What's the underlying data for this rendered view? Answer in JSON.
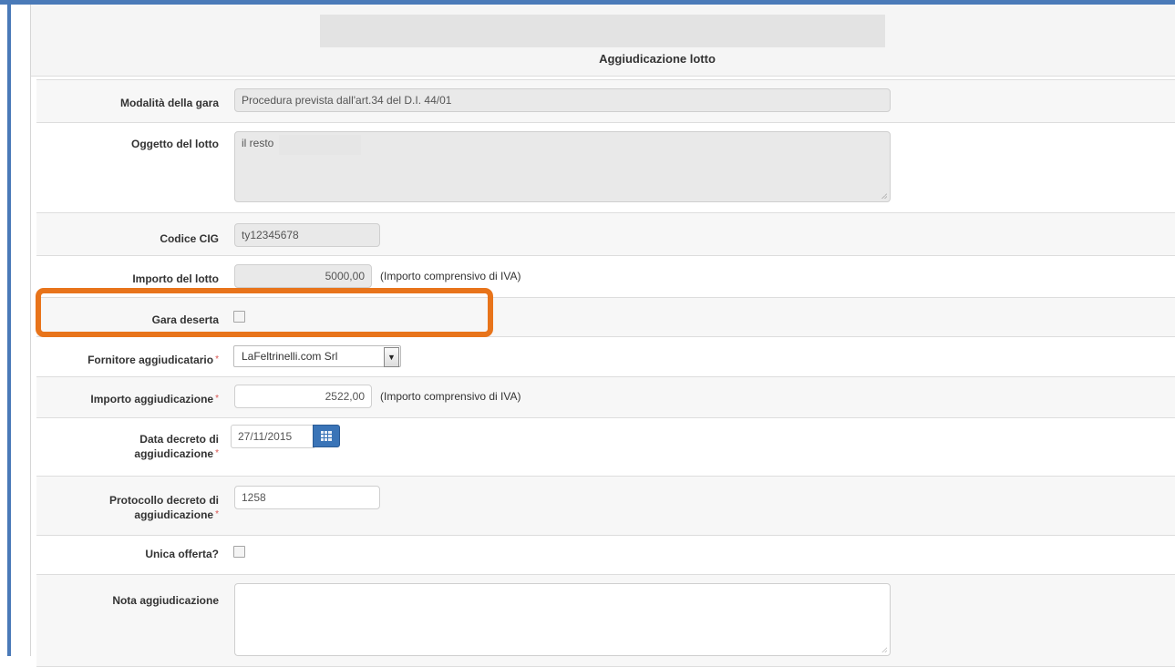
{
  "section": {
    "title": "Aggiudicazione lotto"
  },
  "fields": {
    "modalita": {
      "label": "Modalità  della gara",
      "value": "Procedura prevista dall'art.34 del D.I. 44/01"
    },
    "oggetto": {
      "label": "Oggetto del lotto",
      "value": "il resto"
    },
    "cig": {
      "label": "Codice CIG",
      "value": "ty12345678"
    },
    "importo_lotto": {
      "label": "Importo del lotto",
      "value": "5000,00",
      "hint": "(Importo comprensivo di IVA)"
    },
    "gara_deserta": {
      "label": "Gara deserta",
      "checked": false
    },
    "fornitore": {
      "label": "Fornitore aggiudicatario",
      "value": "LaFeltrinelli.com Srl"
    },
    "importo_aggiudicazione": {
      "label": "Importo aggiudicazione",
      "value": "2522,00",
      "hint": "(Importo comprensivo di IVA)"
    },
    "data_decreto": {
      "label_line1": "Data decreto di",
      "label_line2": "aggiudicazione",
      "value": "27/11/2015"
    },
    "protocollo": {
      "label_line1": "Protocollo decreto di",
      "label_line2": "aggiudicazione",
      "value": "1258"
    },
    "unica_offerta": {
      "label": "Unica offerta?",
      "checked": false
    },
    "nota": {
      "label": "Nota aggiudicazione",
      "value": ""
    }
  },
  "required_marker": "*",
  "colors": {
    "frame": "#4a7ab8",
    "highlight": "#e8741b",
    "required": "#d9534f",
    "calendar_button": "#3a74b7"
  }
}
